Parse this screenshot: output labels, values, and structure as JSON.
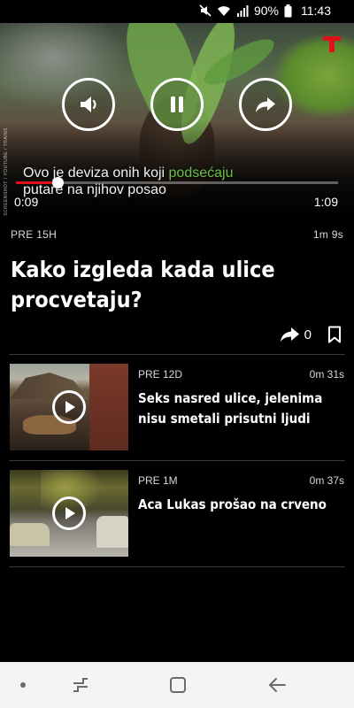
{
  "status_bar": {
    "battery": "90%",
    "time": "11:43",
    "icons": [
      "mute-icon",
      "wifi-icon",
      "signal-icon",
      "battery-icon"
    ]
  },
  "player": {
    "brand_icon": "telegraf-t-logo",
    "credit": "SCREENSHOT / YOUTUBE / TRAINS",
    "caption_text": "Ovo je deviza onih koji ",
    "caption_highlight": "podsećaju",
    "caption_line2": "putare na njihov posao",
    "current_time": "0:09",
    "duration": "1:09",
    "progress_fraction": 0.13,
    "buttons": [
      "volume-icon",
      "pause-icon",
      "share-icon"
    ]
  },
  "article": {
    "age": "PRE 15H",
    "duration": "1m 9s",
    "title": "Kako izgleda kada ulice procvetaju?",
    "share_count": "0"
  },
  "related": [
    {
      "age": "PRE 12D",
      "duration": "0m 31s",
      "title": "Seks nasred ulice, jelenima nisu smetali prisutni ljudi"
    },
    {
      "age": "PRE 1M",
      "duration": "0m 37s",
      "title": "Aca Lukas prošao na crveno"
    }
  ],
  "colors": {
    "accent": "#e0101b",
    "caption_highlight": "#6cc04a",
    "background": "#000000"
  }
}
